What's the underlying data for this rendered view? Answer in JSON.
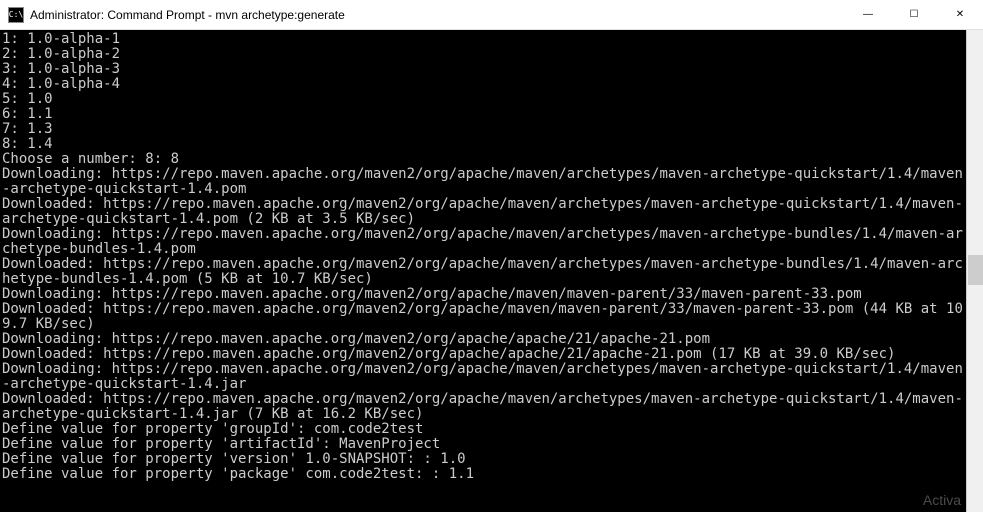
{
  "titlebar": {
    "icon_text": "C:\\",
    "title": "Administrator: Command Prompt - mvn  archetype:generate"
  },
  "window_controls": {
    "minimize": "—",
    "maximize": "☐",
    "close": "✕"
  },
  "terminal": {
    "lines": [
      "1: 1.0-alpha-1",
      "2: 1.0-alpha-2",
      "3: 1.0-alpha-3",
      "4: 1.0-alpha-4",
      "5: 1.0",
      "6: 1.1",
      "7: 1.3",
      "8: 1.4",
      "Choose a number: 8: 8",
      "Downloading: https://repo.maven.apache.org/maven2/org/apache/maven/archetypes/maven-archetype-quickstart/1.4/maven-archetype-quickstart-1.4.pom",
      "Downloaded: https://repo.maven.apache.org/maven2/org/apache/maven/archetypes/maven-archetype-quickstart/1.4/maven-archetype-quickstart-1.4.pom (2 KB at 3.5 KB/sec)",
      "Downloading: https://repo.maven.apache.org/maven2/org/apache/maven/archetypes/maven-archetype-bundles/1.4/maven-archetype-bundles-1.4.pom",
      "Downloaded: https://repo.maven.apache.org/maven2/org/apache/maven/archetypes/maven-archetype-bundles/1.4/maven-archetype-bundles-1.4.pom (5 KB at 10.7 KB/sec)",
      "Downloading: https://repo.maven.apache.org/maven2/org/apache/maven/maven-parent/33/maven-parent-33.pom",
      "Downloaded: https://repo.maven.apache.org/maven2/org/apache/maven/maven-parent/33/maven-parent-33.pom (44 KB at 109.7 KB/sec)",
      "Downloading: https://repo.maven.apache.org/maven2/org/apache/apache/21/apache-21.pom",
      "Downloaded: https://repo.maven.apache.org/maven2/org/apache/apache/21/apache-21.pom (17 KB at 39.0 KB/sec)",
      "Downloading: https://repo.maven.apache.org/maven2/org/apache/maven/archetypes/maven-archetype-quickstart/1.4/maven-archetype-quickstart-1.4.jar",
      "Downloaded: https://repo.maven.apache.org/maven2/org/apache/maven/archetypes/maven-archetype-quickstart/1.4/maven-archetype-quickstart-1.4.jar (7 KB at 16.2 KB/sec)",
      "Define value for property 'groupId': com.code2test",
      "Define value for property 'artifactId': MavenProject",
      "Define value for property 'version' 1.0-SNAPSHOT: : 1.0",
      "Define value for property 'package' com.code2test: : 1.1"
    ]
  },
  "watermark": "Activa"
}
